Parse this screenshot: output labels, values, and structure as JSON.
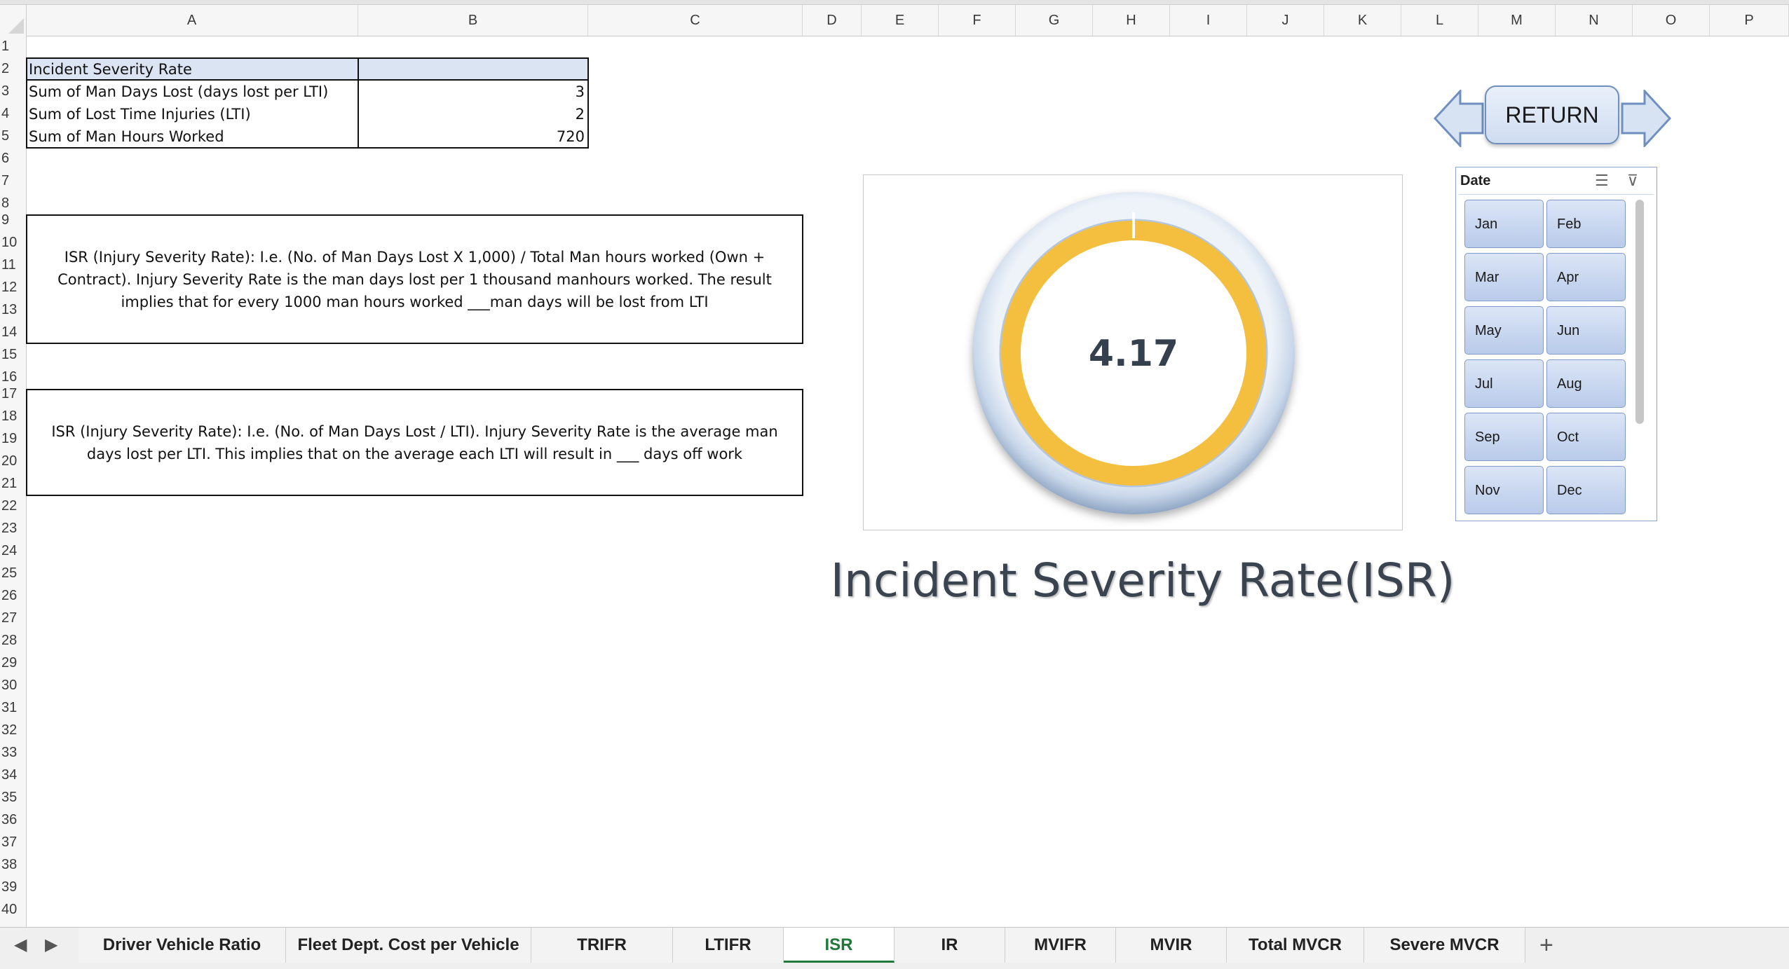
{
  "columns": [
    "A",
    "B",
    "C",
    "D",
    "E",
    "F",
    "G",
    "H",
    "I",
    "J",
    "K",
    "L",
    "M",
    "N",
    "O",
    "P"
  ],
  "rows": [
    "1",
    "2",
    "3",
    "4",
    "5",
    "6",
    "7",
    "8",
    "9",
    "10",
    "11",
    "12",
    "13",
    "14",
    "15",
    "16",
    "17",
    "18",
    "19",
    "20",
    "21",
    "22",
    "23",
    "24",
    "25",
    "26",
    "27",
    "28",
    "29",
    "30",
    "31",
    "32",
    "33",
    "34",
    "35",
    "36",
    "37",
    "38",
    "39",
    "40"
  ],
  "table": {
    "header": "Incident Severity Rate",
    "rows": [
      {
        "label": "Sum of Man Days Lost (days lost per LTI)",
        "value": "3"
      },
      {
        "label": "Sum of Lost Time Injuries  (LTI)",
        "value": "2"
      },
      {
        "label": "Sum of Man Hours Worked",
        "value": "720"
      }
    ]
  },
  "notes": {
    "note1": "ISR (Injury Severity Rate): I.e. (No. of Man Days Lost X 1,000) / Total Man hours worked (Own + Contract). Injury Severity Rate is the man days lost per 1 thousand manhours worked. The result implies that for every 1000 man hours worked ___man days will be lost from LTI",
    "note2": "ISR (Injury Severity Rate): I.e. (No. of Man Days Lost / LTI). Injury Severity Rate is the average man days lost per LTI. This implies that on the average each LTI will result in ___ days off work"
  },
  "chart_data": {
    "type": "pie",
    "value_label": "4.17",
    "ring_color": "#F4BE3E",
    "title": "Incident Severity Rate(ISR)"
  },
  "return_button": "RETURN",
  "slicer": {
    "title": "Date",
    "icons": [
      "multi-select-icon",
      "clear-filter-icon"
    ],
    "months": [
      "Jan",
      "Feb",
      "Mar",
      "Apr",
      "May",
      "Jun",
      "Jul",
      "Aug",
      "Sep",
      "Oct",
      "Nov",
      "Dec"
    ]
  },
  "tabs": [
    "Driver Vehicle Ratio",
    "Fleet Dept. Cost per Vehicle",
    "TRIFR",
    "LTIFR",
    "ISR",
    "IR",
    "MVIFR",
    "MVIR",
    "Total MVCR",
    "Severe MVCR"
  ],
  "active_tab": "ISR",
  "add_sheet_label": "+"
}
